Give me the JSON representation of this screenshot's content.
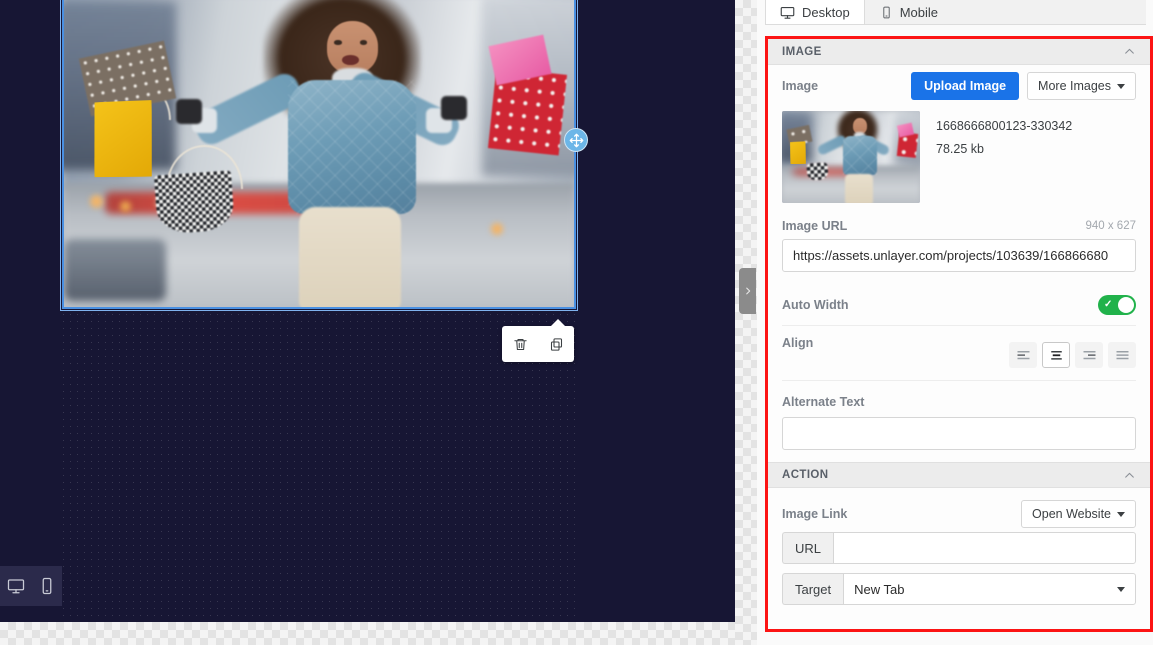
{
  "canvas": {
    "image_alt": "woman-with-shopping-bags-photo",
    "drag_handle_icon": "move-icon",
    "toolbar": {
      "delete_icon": "trash-icon",
      "duplicate_icon": "copy-icon"
    },
    "preview_toggle": {
      "desktop_icon": "desktop-icon",
      "mobile_icon": "mobile-icon"
    },
    "collapse_arrow": "chevron-right-icon"
  },
  "tabs": [
    {
      "label": "Desktop",
      "icon": "desktop-icon",
      "active": true
    },
    {
      "label": "Mobile",
      "icon": "mobile-icon",
      "active": false
    }
  ],
  "image_section": {
    "title": "IMAGE",
    "collapse_icon": "chevron-up-icon",
    "image_label": "Image",
    "upload_button": "Upload Image",
    "more_images_button": "More Images",
    "file_name": "1668666800123-330342",
    "file_size": "78.25 kb",
    "url_label": "Image URL",
    "dimensions": "940 x 627",
    "url_value": "https://assets.unlayer.com/projects/103639/166866680",
    "auto_width_label": "Auto Width",
    "auto_width_on": true,
    "align_label": "Align",
    "align_options": [
      "left",
      "center",
      "right",
      "justify"
    ],
    "align_selected": "center",
    "alternate_text_label": "Alternate Text",
    "alternate_text_value": ""
  },
  "action_section": {
    "title": "ACTION",
    "collapse_icon": "chevron-up-icon",
    "image_link_label": "Image Link",
    "image_link_value": "Open Website",
    "url_prefix": "URL",
    "url_value": "",
    "target_prefix": "Target",
    "target_value": "New Tab"
  },
  "colors": {
    "accent_blue": "#1a73e8",
    "toggle_green": "#21b24b",
    "annotation_red": "#fc1414",
    "canvas_bg": "#171634",
    "selection_blue": "#4a90e2"
  }
}
